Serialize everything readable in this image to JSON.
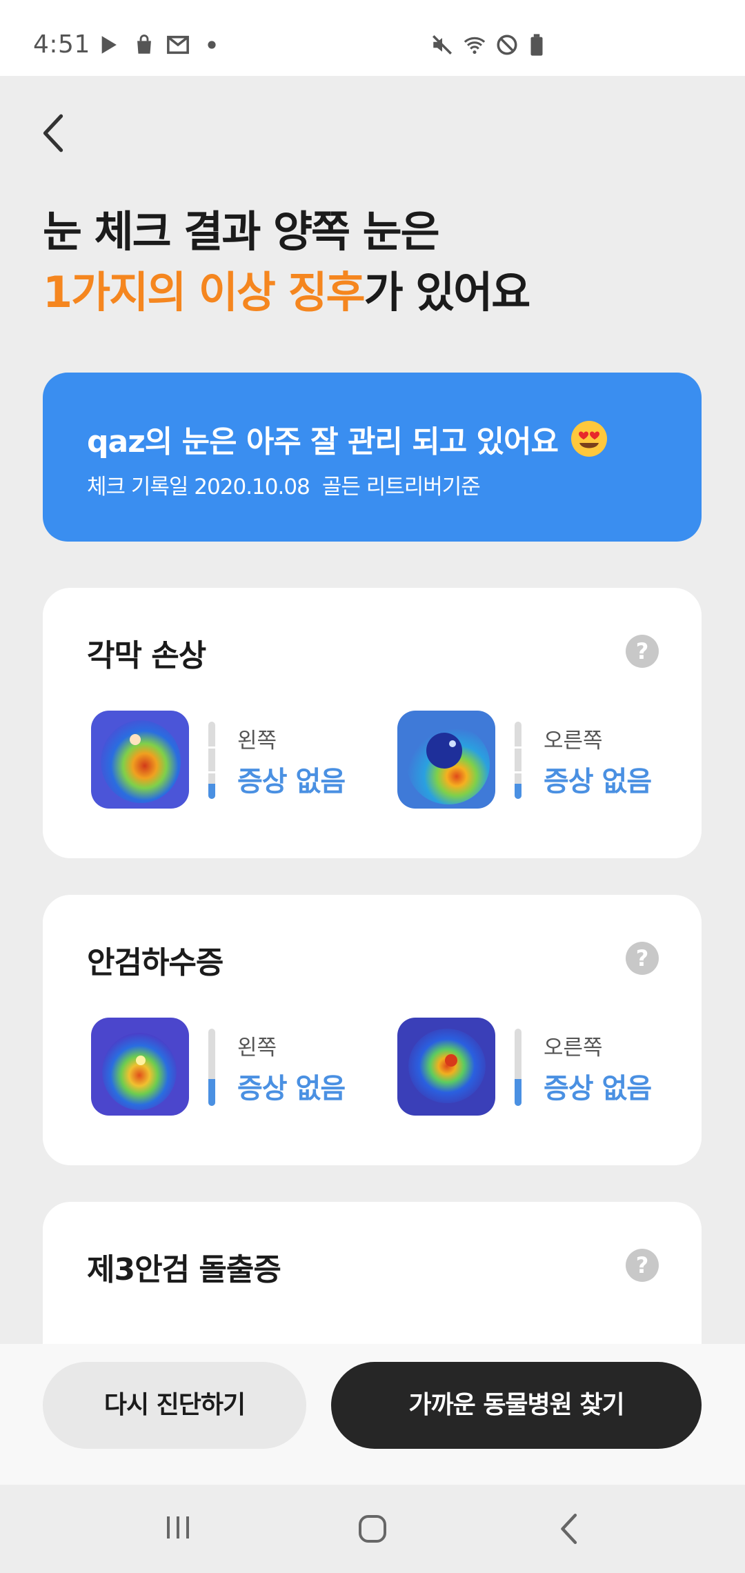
{
  "status_bar": {
    "time": "4:51",
    "left_icons": [
      "play-store-icon",
      "shopping-bag-icon",
      "gmail-icon",
      "dot-icon"
    ],
    "right_icons": [
      "mute-icon",
      "wifi-icon",
      "do-not-disturb-icon",
      "battery-icon"
    ]
  },
  "header": {
    "back_icon": "chevron-left-icon",
    "headline_line1": "눈 체크 결과 양쪽 눈은",
    "headline_accent": "1가지의 이상 징후",
    "headline_rest": "가 있어요",
    "accent_color": "#f5861f"
  },
  "banner": {
    "message": "qaz의 눈은 아주 잘 관리 되고 있어요",
    "emoji": "heart-eyes-emoji-icon",
    "record_label": "체크 기록일 2020.10.08",
    "breed_label": "골든 리트리버기준",
    "color": "#3a8ef0"
  },
  "cards": [
    {
      "title": "각막 손상",
      "help": "?",
      "left": {
        "side": "왼쪽",
        "status": "증상 없음",
        "level": 0.2
      },
      "right": {
        "side": "오른쪽",
        "status": "증상 없음",
        "level": 0.2
      }
    },
    {
      "title": "안검하수증",
      "help": "?",
      "left": {
        "side": "왼쪽",
        "status": "증상 없음",
        "level": 0.35
      },
      "right": {
        "side": "오른쪽",
        "status": "증상 없음",
        "level": 0.35
      }
    },
    {
      "title": "제3안검 돌출증",
      "help": "?"
    }
  ],
  "actions": {
    "retry": "다시 진단하기",
    "find_hospital": "가까운 동물병원 찾기"
  },
  "nav": [
    "recent-apps-icon",
    "home-icon",
    "back-icon"
  ]
}
